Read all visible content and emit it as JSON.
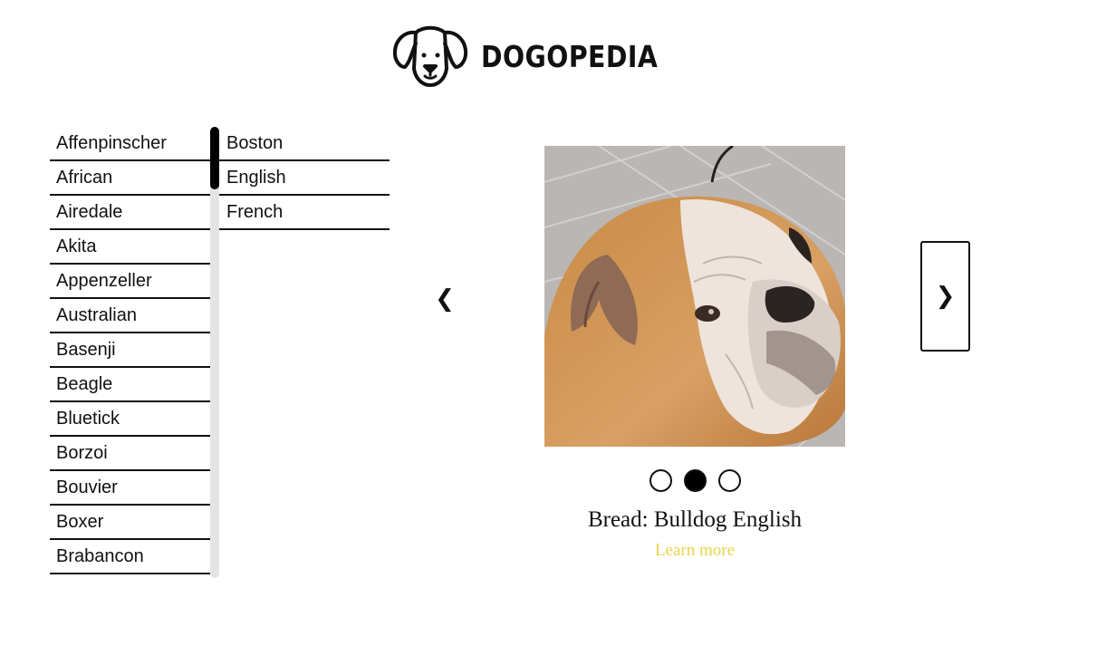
{
  "header": {
    "brand": "DOGOPEDIA",
    "logo_icon": "dog-face-icon"
  },
  "breeds": [
    "Affenpinscher",
    "African",
    "Airedale",
    "Akita",
    "Appenzeller",
    "Australian",
    "Basenji",
    "Beagle",
    "Bluetick",
    "Borzoi",
    "Bouvier",
    "Boxer",
    "Brabancon"
  ],
  "sub_breeds": [
    "Boston",
    "English",
    "French"
  ],
  "carousel": {
    "prev_label": "❮",
    "next_label": "❯",
    "image_subject": "English bulldog photo",
    "slide_count": 3,
    "active_slide": 2,
    "caption": "Bread: Bulldog English",
    "learn_more": "Learn more"
  },
  "colors": {
    "link": "#e8d34a",
    "text": "#111111",
    "scrollbar_track": "#e4e4e4"
  }
}
